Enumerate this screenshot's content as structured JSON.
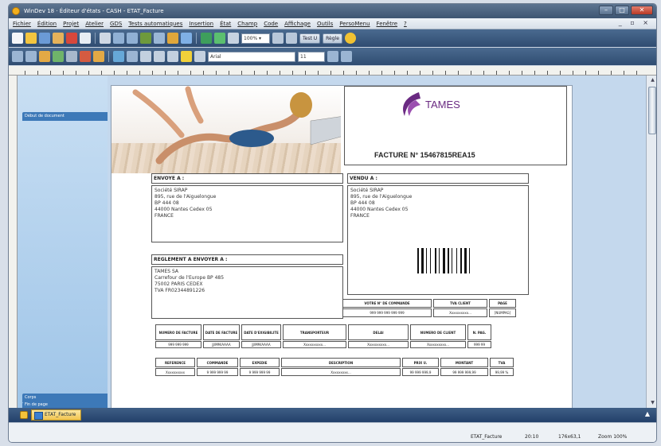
{
  "window": {
    "title": "WinDev 18 · Éditeur d'états - CASH - ETAT_Facture"
  },
  "menu": [
    "Fichier",
    "Édition",
    "Projet",
    "Atelier",
    "GDS",
    "Tests automatiques",
    "Insertion",
    "État",
    "Champ",
    "Code",
    "Affichage",
    "Outils",
    "PersoMenu",
    "Fenêtre",
    "?"
  ],
  "toolbar": {
    "zoom": "100% ▾",
    "test_label": "Test U",
    "style_label": "Règle",
    "font": "Arial",
    "size": "11"
  },
  "left_panel": {
    "sections": [
      "Début de document",
      "Corps",
      "Fin de page"
    ]
  },
  "invoice": {
    "brand": "TAMES",
    "title": "FACTURE N° 15467815REA15",
    "sender": {
      "header": "ENVOYE A :",
      "lines": [
        "Société SIRAP",
        "895, rue de l'Aiguelongue",
        "BP 444 08",
        "44000 Nantes Cedex 05",
        "FRANCE"
      ]
    },
    "buyer": {
      "header": "VENDU A :",
      "lines": [
        "Société SIRAP",
        "895, rue de l'Aiguelongue",
        "BP 444 08",
        "44000 Nantes Cedex 05",
        "FRANCE"
      ]
    },
    "payment": {
      "header": "REGLEMENT A ENVOYER A :",
      "lines": [
        "TAMES SA",
        "Carrefour de l'Europe BP 485",
        "75002 PARIS CEDEX",
        "TVA FR02344891226"
      ]
    },
    "order_table": {
      "headers": [
        "VOTRE N° DE COMMANDE",
        "TVA CLIENT",
        "PAGE"
      ],
      "values": [
        "999 999 999 999 999",
        "Xxxxxxxxxx...",
        "[NUMPAG]"
      ]
    },
    "info_table": {
      "headers": [
        "NUMERO DE FACTURE",
        "DATE DE FACTURE",
        "DATE D'EXIGIBILITE",
        "TRANSPORTEUR",
        "DELAI",
        "NUMERO DE CLIENT",
        "N. PAG."
      ],
      "values": [
        "999 999 999",
        "JJ/MM/AAAA",
        "JJ/MM/AAAA",
        "Xxxxxxxxxx...",
        "Xxxxxxxxxx...",
        "Xxxxxxxxxx...",
        "999 99"
      ]
    },
    "lines_table": {
      "headers": [
        "REFERENCE",
        "COMMANDE",
        "EXPEDIE",
        "DESCRIPTION",
        "PRIX U.",
        "MONTANT",
        "TVA"
      ],
      "values": [
        "Xxxxxxxxxx",
        "9 999 999 99",
        "9 999 999 99",
        "Xxxxxxxxx...",
        "99 999 999,9",
        "99 999 999,99",
        "99,99 %"
      ]
    }
  },
  "tabbar": {
    "tab": "ETAT_Facture"
  },
  "status": {
    "name": "ETAT_Facture",
    "pos": "20:10",
    "size": "176x63,1",
    "zoom": "Zoom 100%"
  },
  "colors": {
    "brand": "#6a2a82",
    "accent": "#3d79b8"
  }
}
